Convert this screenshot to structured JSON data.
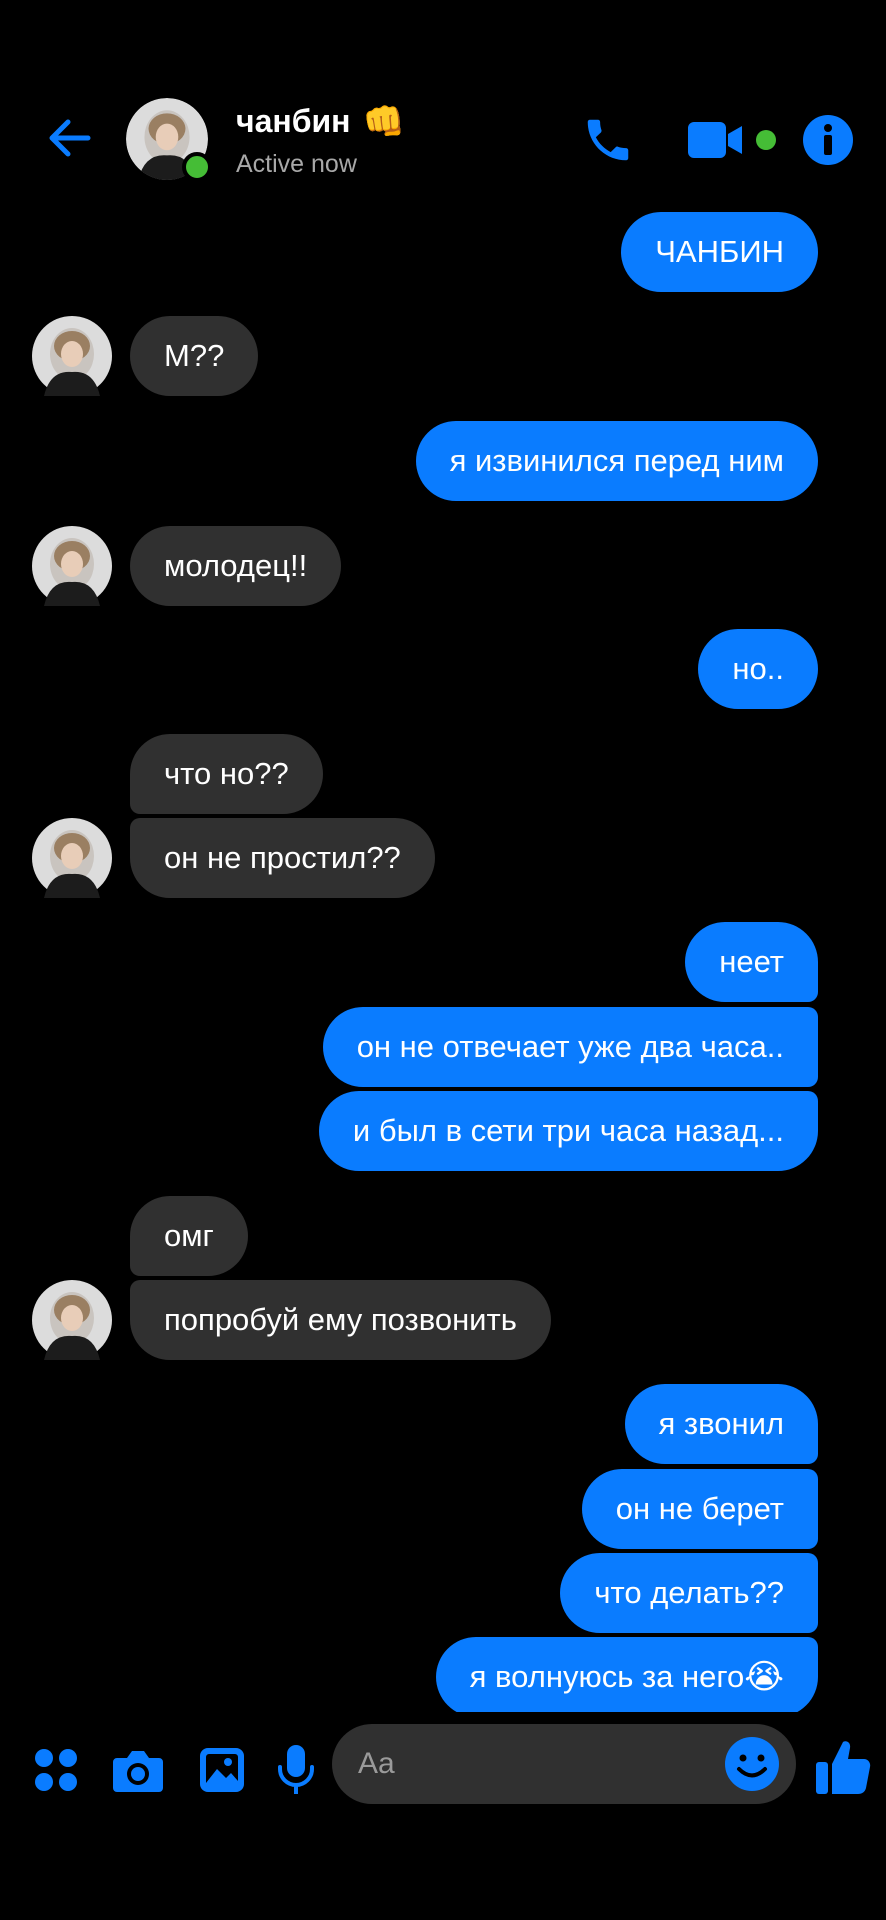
{
  "colors": {
    "accent": "#0a7cff",
    "incoming_bubble": "#303030",
    "online": "#45bd36",
    "background": "#000000"
  },
  "header": {
    "contact_name": "чанбин",
    "name_emoji": "👊",
    "status": "Active now",
    "icons": [
      "back-arrow-icon",
      "avatar",
      "phone-icon",
      "video-camera-icon",
      "info-icon"
    ]
  },
  "messages": [
    {
      "dir": "out",
      "text": "ЧАНБИН"
    },
    {
      "dir": "in",
      "text": "М??"
    },
    {
      "dir": "out",
      "text": "я извинился перед ним"
    },
    {
      "dir": "in",
      "text": "молодец!!"
    },
    {
      "dir": "out",
      "text": "но.."
    },
    {
      "dir": "in",
      "text": "что но??"
    },
    {
      "dir": "in",
      "text": "он не простил??"
    },
    {
      "dir": "out",
      "text": "неет"
    },
    {
      "dir": "out",
      "text": "он не отвечает уже два часа.."
    },
    {
      "dir": "out",
      "text": "и был в сети три часа назад..."
    },
    {
      "dir": "in",
      "text": "омг"
    },
    {
      "dir": "in",
      "text": "попробуй ему позвонить"
    },
    {
      "dir": "out",
      "text": "я звонил"
    },
    {
      "dir": "out",
      "text": "он не берет"
    },
    {
      "dir": "out",
      "text": "что делать??"
    },
    {
      "dir": "out",
      "text": "я волнуюсь за него"
    }
  ],
  "last_message_emoji": "😭",
  "composer": {
    "placeholder": "Aa",
    "icons": [
      "apps-icon",
      "camera-icon",
      "image-icon",
      "microphone-icon",
      "emoji-icon",
      "thumbs-up-icon"
    ]
  }
}
